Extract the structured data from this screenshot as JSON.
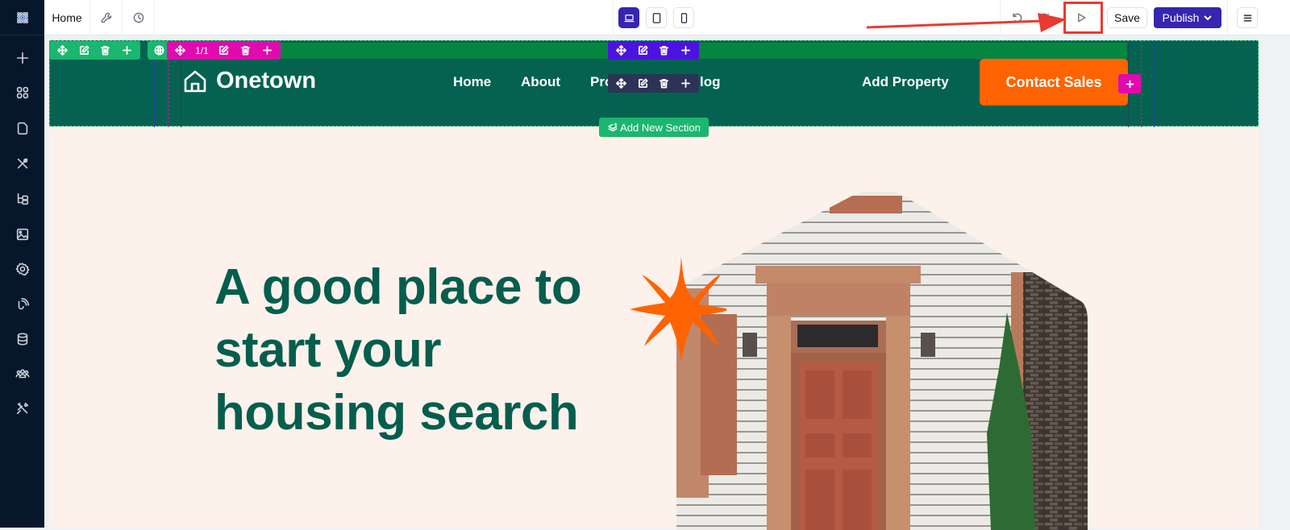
{
  "app": {
    "page_tab": "Home",
    "toolbar": {
      "save_label": "Save",
      "publish_label": "Publish",
      "devices": [
        "desktop",
        "tablet",
        "mobile"
      ],
      "active_device": "desktop"
    },
    "rail_items": [
      "add",
      "components",
      "pages",
      "design",
      "navigator",
      "media",
      "settings",
      "integrations",
      "database",
      "users",
      "tools"
    ]
  },
  "annotation": {
    "target": "preview-button",
    "color": "#ea3a2f"
  },
  "editor": {
    "section_toolbar_page_count": "1/1",
    "add_section_label": "Add New Section"
  },
  "site": {
    "logo_text": "Onetown",
    "nav": [
      "Home",
      "About",
      "Properties",
      "Blog"
    ],
    "nav_visible_fragments": {
      "properties": "Pro",
      "blog": "log"
    },
    "add_property_label": "Add Property",
    "cta_label": "Contact Sales",
    "hero_title": "A good place to start your housing search",
    "colors": {
      "header_bg": "#056250",
      "accent_orange": "#fe6301",
      "hero_bg": "#fdf1ec",
      "title_green": "#055e4d"
    }
  }
}
